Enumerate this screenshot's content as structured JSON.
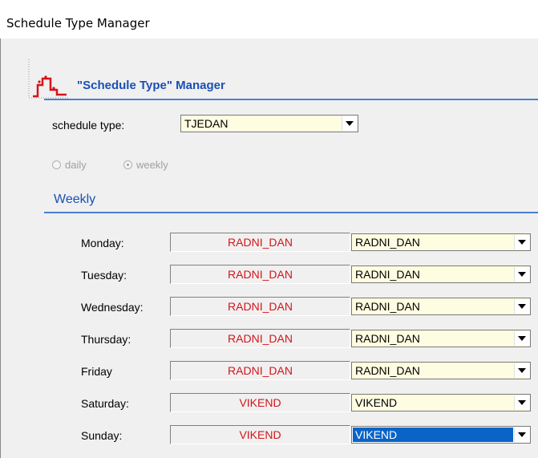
{
  "window": {
    "title": "Schedule Type Manager"
  },
  "header": {
    "title": "\"Schedule Type\" Manager"
  },
  "schedule_type": {
    "label": "schedule type:",
    "value": "TJEDAN"
  },
  "mode": {
    "daily_label": "daily",
    "weekly_label": "weekly",
    "selected": "weekly"
  },
  "weekly_section": {
    "title": "Weekly"
  },
  "days": [
    {
      "label": "Monday:",
      "current": "RADNI_DAN",
      "selection": "RADNI_DAN"
    },
    {
      "label": "Tuesday:",
      "current": "RADNI_DAN",
      "selection": "RADNI_DAN"
    },
    {
      "label": "Wednesday:",
      "current": "RADNI_DAN",
      "selection": "RADNI_DAN"
    },
    {
      "label": "Thursday:",
      "current": "RADNI_DAN",
      "selection": "RADNI_DAN"
    },
    {
      "label": "Friday",
      "current": "RADNI_DAN",
      "selection": "RADNI_DAN"
    },
    {
      "label": "Saturday:",
      "current": "VIKEND",
      "selection": "VIKEND"
    },
    {
      "label": "Sunday:",
      "current": "VIKEND",
      "selection": "VIKEND"
    }
  ],
  "colors": {
    "accent": "#1a4fb4",
    "current_value_text": "#d4141a",
    "combo_bg": "#fffde1",
    "highlight": "#0a64c8"
  }
}
